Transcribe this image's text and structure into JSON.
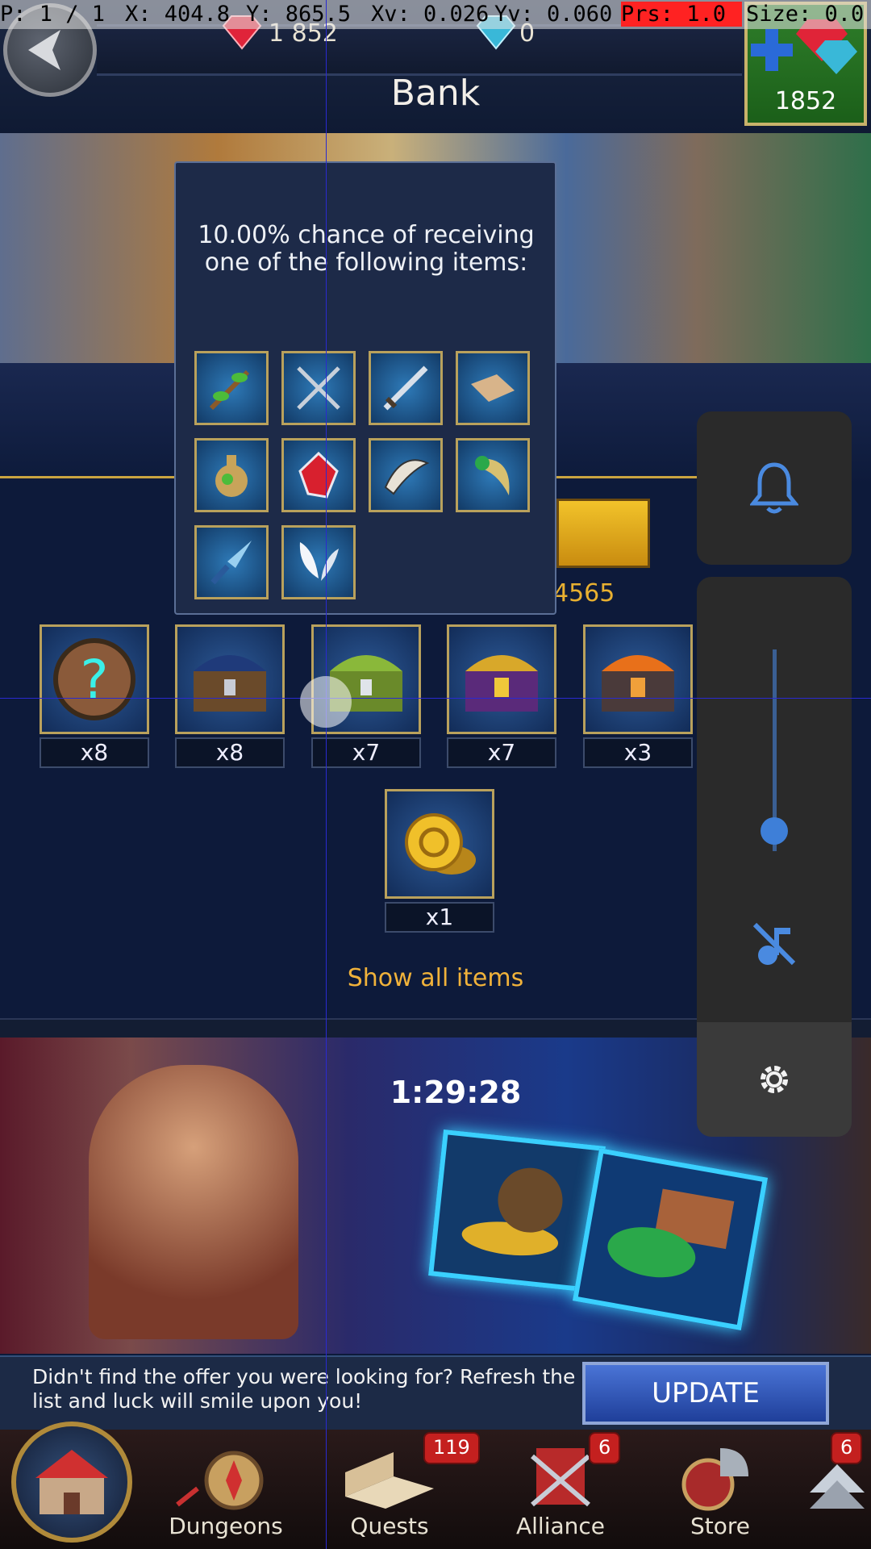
{
  "debug": {
    "pointer": "P: 1 / 1",
    "x": "X: 404.8",
    "y": "Y: 865.5",
    "xv": "Xv: 0.026",
    "yv": "Yv: 0.060",
    "prs": "Prs: 1.0",
    "size": "Size: 0.0"
  },
  "header": {
    "title": "Bank",
    "red_gems": "1 852",
    "blue_gems": "0",
    "gem_shop_value": "1852"
  },
  "background": {
    "price_fragment": "4565"
  },
  "popup": {
    "text": "10.00% chance of receiving one of the following items:",
    "items": [
      {
        "icon": "branch-icon"
      },
      {
        "icon": "crossed-swords-icon"
      },
      {
        "icon": "sword-icon"
      },
      {
        "icon": "scroll-icon"
      },
      {
        "icon": "potion-icon"
      },
      {
        "icon": "ruby-icon"
      },
      {
        "icon": "horn-icon"
      },
      {
        "icon": "fang-icon"
      },
      {
        "icon": "crystal-blade-icon"
      },
      {
        "icon": "wings-icon"
      }
    ]
  },
  "rewards": [
    {
      "icon": "mystery-chest-icon",
      "qty": "x8"
    },
    {
      "icon": "blue-chest-icon",
      "qty": "x8"
    },
    {
      "icon": "green-chest-icon",
      "qty": "x7"
    },
    {
      "icon": "purple-chest-icon",
      "qty": "x7"
    },
    {
      "icon": "fire-chest-icon",
      "qty": "x3"
    },
    {
      "icon": "gold-coins-icon",
      "qty": "x1"
    }
  ],
  "show_all": "Show all items",
  "offer": {
    "timer": "1:29:28",
    "text": "Didn't find the offer you were looking for? Refresh the list and luck will smile upon you!",
    "update_label": "UPDATE"
  },
  "nav": {
    "items": [
      {
        "label": "",
        "icon": "castle-icon"
      },
      {
        "label": "Dungeons",
        "icon": "compass-icon"
      },
      {
        "label": "Quests",
        "icon": "book-icon",
        "badge": "119"
      },
      {
        "label": "Alliance",
        "icon": "banner-icon",
        "badge": "6"
      },
      {
        "label": "Store",
        "icon": "helmet-shield-icon"
      },
      {
        "label": "",
        "icon": "arrow-up-icon",
        "badge": "6"
      }
    ]
  },
  "volume_panel": {
    "level": 0.1,
    "bell_icon": "bell-icon",
    "mute_icon": "music-off-icon",
    "settings_icon": "gear-icon",
    "accent": "#3e7fd8"
  }
}
